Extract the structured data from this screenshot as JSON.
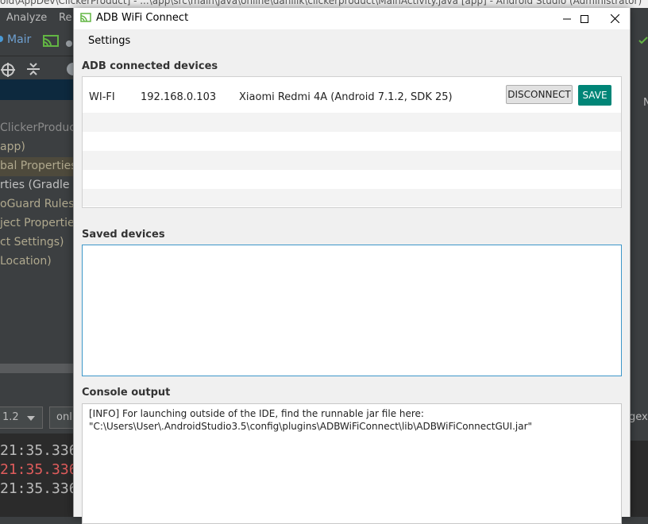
{
  "ide": {
    "title": "oid\\AppDev\\ClickerProduct] - ...\\app\\src\\main\\java\\online\\danilik\\clickerproduct\\MainActivity.java [app] - Android Studio (Administrator)",
    "menu": [
      "Analyze",
      "Re"
    ],
    "run_config": "Mair",
    "tree": [
      "ClickerProduct",
      "app)",
      "bal Properties",
      "rties (Gradle Ve",
      "oGuard Rules f",
      "ject Properties",
      "ct Settings)",
      "Location)"
    ],
    "device_combo": "1.2",
    "filter_combo": "onl",
    "regex_label": "gex",
    "log_lines": [
      "21:35.336",
      "21:35.336",
      "21:35.336"
    ],
    "right_letter": "N"
  },
  "dialog": {
    "title": "ADB WiFi Connect",
    "menu_settings": "Settings",
    "connected_label": "ADB connected devices",
    "device": {
      "type": "WI-FI",
      "ip": "192.168.0.103",
      "name": "Xiaomi Redmi 4A (Android 7.1.2, SDK 25)",
      "disconnect": "DISCONNECT",
      "save": "SAVE"
    },
    "saved_label": "Saved devices",
    "console_label": "Console output",
    "console_lines": [
      "[INFO]  For launching outside of the IDE, find the runnable jar file here:",
      "\"C:\\Users\\User\\.AndroidStudio3.5\\config\\plugins\\ADBWiFiConnect\\lib\\ADBWiFiConnectGUI.jar\""
    ]
  },
  "colors": {
    "save_button": "#008577",
    "focus_border": "#3d97c9",
    "ide_background": "#3c3f41"
  }
}
